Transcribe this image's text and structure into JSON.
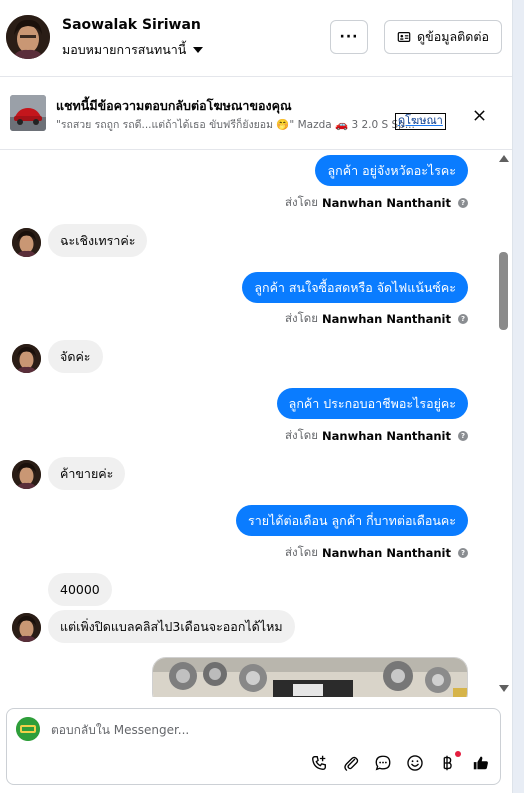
{
  "header": {
    "contact_name": "Saowalak Siriwan",
    "assign_label": "มอบหมายการสนทนานี้",
    "more_label": "···",
    "contact_info_label": "ดูข้อมูลติดต่อ"
  },
  "ad_banner": {
    "title": "แชทนี้มีข้อความตอบกลับต่อโฆษณาของคุณ",
    "snippet": "\"รถสวย รถถูก รถดี...แต่ถ้าได้เธอ ขับฟรีก็ยังยอม 🤭\" Mazda 🚗 3 2.0 S Sp...",
    "view_ad_label": "ดูโฆษณา"
  },
  "messages": [
    {
      "type": "out",
      "text": "ลูกค้า อยู่จังหวัดอะไรคะ"
    },
    {
      "type": "sentby",
      "prefix": "ส่งโดย",
      "name": "Nanwhan Nanthanit"
    },
    {
      "type": "in",
      "text": "ฉะเชิงเทราค่ะ"
    },
    {
      "type": "out",
      "text": "ลูกค้า สนใจซื้อสดหรือ  จัดไฟแน้นซ์คะ"
    },
    {
      "type": "sentby",
      "prefix": "ส่งโดย",
      "name": "Nanwhan Nanthanit"
    },
    {
      "type": "in",
      "text": "จัดค่ะ"
    },
    {
      "type": "out",
      "text": "ลูกค้า ประกอบอาชีพอะไรอยู่คะ"
    },
    {
      "type": "sentby",
      "prefix": "ส่งโดย",
      "name": "Nanwhan Nanthanit"
    },
    {
      "type": "in",
      "text": "ค้าขายค่ะ"
    },
    {
      "type": "out",
      "text": "รายได้ต่อเดือน ลูกค้า กี่บาทต่อเดือนคะ"
    },
    {
      "type": "sentby",
      "prefix": "ส่งโดย",
      "name": "Nanwhan Nanthanit"
    },
    {
      "type": "in",
      "text": "40000"
    },
    {
      "type": "in",
      "text": "แต่เพิ่งปิดแบลคลิสไป3เดือนจะออกได้ไหม"
    }
  ],
  "composer": {
    "placeholder": "ตอบกลับใน Messenger...",
    "tools": [
      "call-add-icon",
      "attachment-icon",
      "saved-reply-icon",
      "emoji-icon",
      "payment-baht-icon",
      "like-icon"
    ]
  },
  "colors": {
    "outgoing_bubble": "#0a7cff",
    "incoming_bubble": "#f0f0f0",
    "notification_dot": "#e41e3f"
  }
}
